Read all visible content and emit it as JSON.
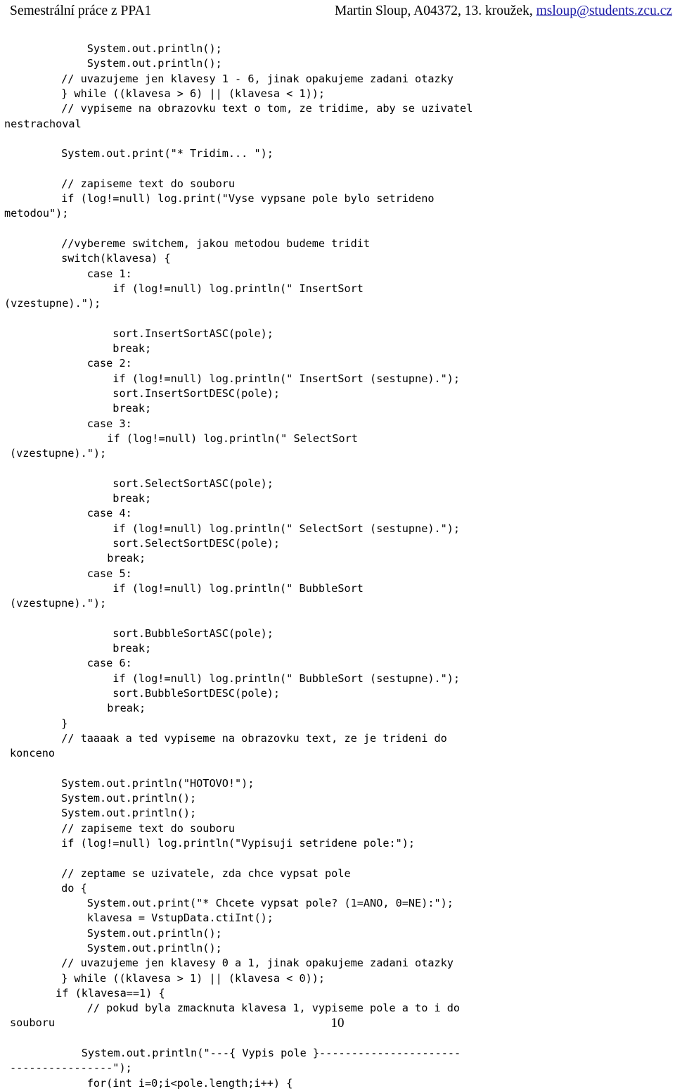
{
  "header": {
    "left_title": "Semestrální práce z PPA1",
    "author_line": "Martin Sloup, A04372, 13. kroužek, ",
    "email": "msloup@students.zcu.cz",
    "link_color": "#1a19a6"
  },
  "footer": {
    "page_number": "10"
  },
  "code": {
    "language": "java",
    "indent_unit": "    ",
    "lines": [
      "            System.out.println();",
      "            System.out.println();",
      "        // uvazujeme jen klavesy 1 - 6, jinak opakujeme zadani otazky",
      "        } while ((klavesa > 6) || (klavesa < 1));",
      "        // vypiseme na obrazovku text o tom, ze tridime, aby se uzivatel",
      "nestrachoval",
      "",
      "        System.out.print(\"* Tridim... \");",
      "",
      "        // zapiseme text do souboru",
      "        if (log!=null) log.print(\"Vyse vypsane pole bylo setrideno",
      "metodou\");",
      "",
      "        //vybereme switchem, jakou metodou budeme tridit",
      "        switch(klavesa) {",
      "            case 1:",
      "                if (log!=null) log.println(\" InsertSort",
      "(vzestupne).\");",
      "",
      "                sort.InsertSortASC(pole);",
      "                break;",
      "            case 2:",
      "                if (log!=null) log.println(\" InsertSort (sestupne).\");",
      "                sort.InsertSortDESC(pole);",
      "                break;",
      "            case 3:",
      "                if (log!=null) log.println(\" SelectSort",
      "(vzestupne).\");",
      "",
      "                sort.SelectSortASC(pole);",
      "                break;",
      "            case 4:",
      "                if (log!=null) log.println(\" SelectSort (sestupne).\");",
      "                sort.SelectSortDESC(pole);",
      "                break;",
      "            case 5:",
      "                if (log!=null) log.println(\" BubbleSort",
      "(vzestupne).\");",
      "",
      "                sort.BubbleSortASC(pole);",
      "                break;",
      "            case 6:",
      "                if (log!=null) log.println(\" BubbleSort (sestupne).\");",
      "                sort.BubbleSortDESC(pole);",
      "                break;",
      "        }",
      "        // taaaak a ted vypiseme na obrazovku text, ze je trideni do",
      "konceno",
      "",
      "        System.out.println(\"HOTOVO!\");",
      "        System.out.println();",
      "        System.out.println();",
      "        // zapiseme text do souboru",
      "        if (log!=null) log.println(\"Vypisuji setridene pole:\");",
      "",
      "        // zeptame se uzivatele, zda chce vypsat pole",
      "        do {",
      "            System.out.print(\"* Chcete vypsat pole? (1=ANO, 0=NE):\");",
      "            klavesa = VstupData.ctiInt();",
      "            System.out.println();",
      "            System.out.println();",
      "        // uvazujeme jen klavesy 0 a 1, jinak opakujeme zadani otazky",
      "        } while ((klavesa > 1) || (klavesa < 0));",
      "        if (klavesa==1) {",
      "            // pokud byla zmacknuta klavesa 1, vypiseme pole a to i do",
      "souboru",
      "",
      "            System.out.println(\"---{ Vypis pole }----------------------",
      "----------------\");",
      "            for(int i=0;i<pole.length;i++) {"
    ],
    "wrap_line_indices": [
      5,
      11,
      17,
      26,
      34,
      44,
      63,
      67
    ]
  }
}
